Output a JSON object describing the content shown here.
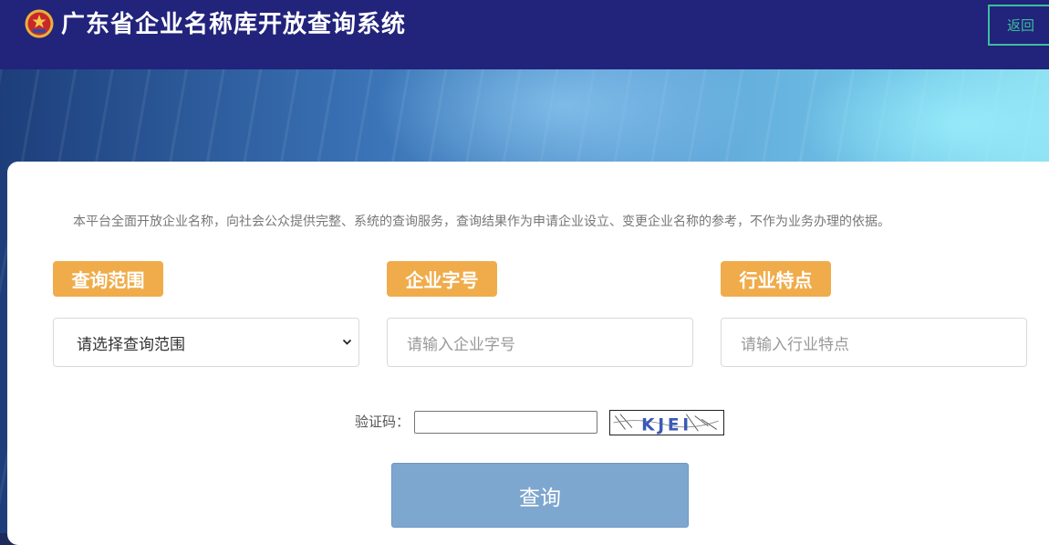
{
  "header": {
    "title": "广东省企业名称库开放查询系统",
    "back_label": "返回"
  },
  "notice": "本平台全面开放企业名称，向社会公众提供完整、系统的查询服务，查询结果作为申请企业设立、变更企业名称的参考，不作为业务办理的依据。",
  "fields": {
    "scope": {
      "label": "查询范围",
      "selected": "请选择查询范围"
    },
    "name": {
      "label": "企业字号",
      "placeholder": "请输入企业字号"
    },
    "industry": {
      "label": "行业特点",
      "placeholder": "请输入行业特点"
    }
  },
  "captcha": {
    "label": "验证码：",
    "value": "",
    "image_text": "KJEI"
  },
  "query_label": "查询",
  "colors": {
    "header_bg": "#22237b",
    "label_bg": "#f0ac4b",
    "back_border": "#3bbf9b",
    "query_bg": "#7ea7cf"
  },
  "icons": {
    "logo": "police-emblem-icon",
    "select_arrow": "chevron-down-icon"
  }
}
